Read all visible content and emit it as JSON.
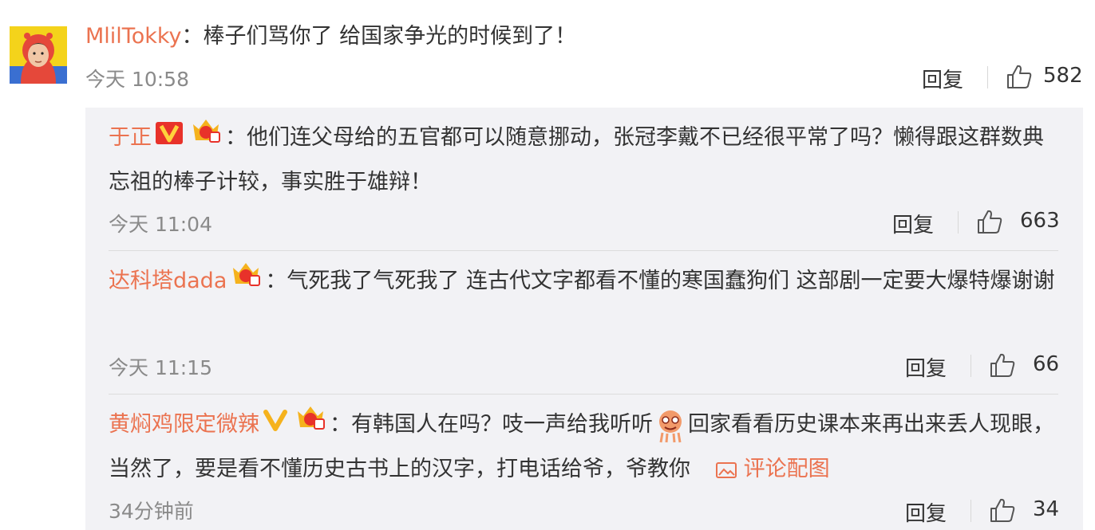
{
  "main_comment": {
    "username": "MlilTokky",
    "text": "：棒子们骂你了 给国家争光的时候到了！",
    "time": "今天 10:58",
    "reply_label": "回复",
    "likes": "582"
  },
  "replies": [
    {
      "username": "于正",
      "text": "：他们连父母给的五官都可以随意挪动，张冠李戴不已经很平常了吗？懒得跟这群数典忘祖的棒子计较，事实胜于雄辩！",
      "time": "今天 11:04",
      "reply_label": "回复",
      "likes": "663"
    },
    {
      "username": "达科塔dada",
      "text": "：气死我了气死我了 连古代文字都看不懂的寒国蠢狗们 这部剧一定要大爆特爆谢谢",
      "time": "今天 11:15",
      "reply_label": "回复",
      "likes": "66"
    },
    {
      "username": "黄焖鸡限定微辣",
      "text_before": "：有韩国人在吗？吱一声给我听听",
      "text_after": "回家看看历史课本来再出来丢人现眼，当然了，要是看不懂历史古书上的汉字，打电话给爷，爷教你",
      "picture_link": "评论配图",
      "time": "34分钟前",
      "reply_label": "回复",
      "likes": "34"
    }
  ],
  "colors": {
    "username": "#eb7350",
    "vip_red": "#e8322a",
    "vip_gold": "#f5b21d",
    "reply_bg": "#f2f2f5"
  }
}
